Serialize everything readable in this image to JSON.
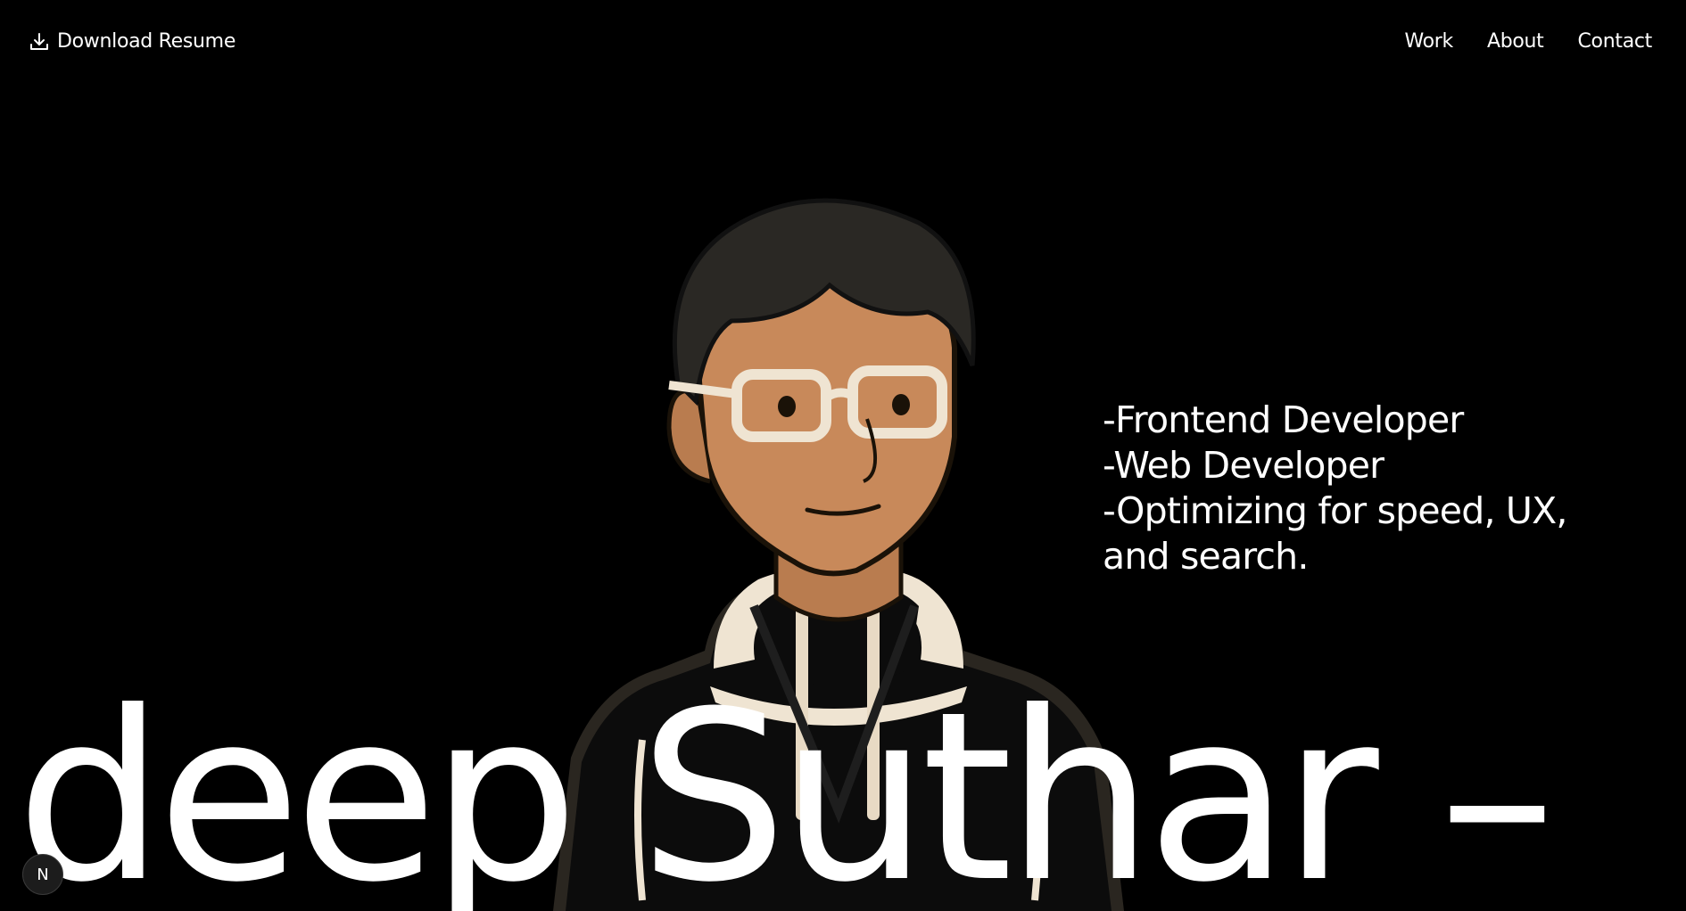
{
  "header": {
    "resume_label": "Download Resume",
    "resume_icon": "download-icon",
    "nav": [
      {
        "label": "Work"
      },
      {
        "label": "About"
      },
      {
        "label": "Contact"
      }
    ]
  },
  "hero": {
    "roles": [
      "-Frontend Developer",
      "-Web Developer",
      "-Optimizing for speed, UX, and search."
    ],
    "marquee_text": "deep Suthar –",
    "avatar": "illustrated-portrait"
  },
  "badge": {
    "label": "N"
  },
  "colors": {
    "background": "#000000",
    "text": "#ffffff",
    "skin": "#c8895a",
    "hoodie": "#0c0c0c",
    "glasses": "#efe4d2"
  }
}
